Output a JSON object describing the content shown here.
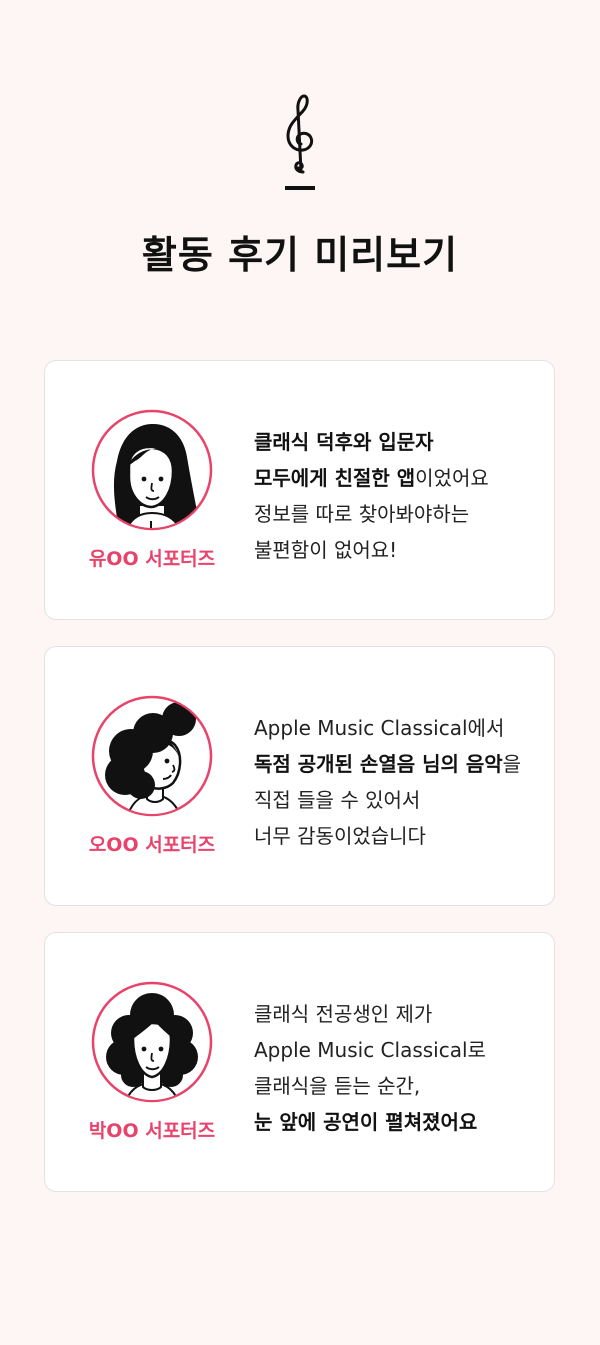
{
  "header": {
    "title": "활동 후기 미리보기",
    "icon": "treble-clef-icon"
  },
  "colors": {
    "accent": "#e8436a",
    "background": "#fdf6f5",
    "card": "#ffffff"
  },
  "reviews": [
    {
      "name": "유OO 서포터즈",
      "lines": [
        [
          {
            "t": "클래식 덕후와 입문자",
            "b": true
          }
        ],
        [
          {
            "t": "모두에게 친절한 앱",
            "b": true
          },
          {
            "t": "이었어요",
            "b": false
          }
        ],
        [
          {
            "t": "정보를 따로 찾아봐야하는",
            "b": false
          }
        ],
        [
          {
            "t": "불편함이 없어요!",
            "b": false
          }
        ]
      ]
    },
    {
      "name": "오OO 서포터즈",
      "lines": [
        [
          {
            "t": "Apple Music Classical",
            "b": false
          },
          {
            "t": "에서",
            "b": false
          }
        ],
        [
          {
            "t": "독점 공개된 손열음 님의 음악",
            "b": true
          },
          {
            "t": "을",
            "b": false
          }
        ],
        [
          {
            "t": "직접 들을 수 있어서",
            "b": false
          }
        ],
        [
          {
            "t": "너무 감동이었습니다",
            "b": false
          }
        ]
      ]
    },
    {
      "name": "박OO 서포터즈",
      "lines": [
        [
          {
            "t": "클래식 전공생인 제가",
            "b": false
          }
        ],
        [
          {
            "t": "Apple Music Classical",
            "b": false
          },
          {
            "t": "로",
            "b": false
          }
        ],
        [
          {
            "t": "클래식을 듣는 순간,",
            "b": false
          }
        ],
        [
          {
            "t": "눈 앞에 공연이 펼쳐졌어요",
            "b": true
          }
        ]
      ]
    }
  ]
}
